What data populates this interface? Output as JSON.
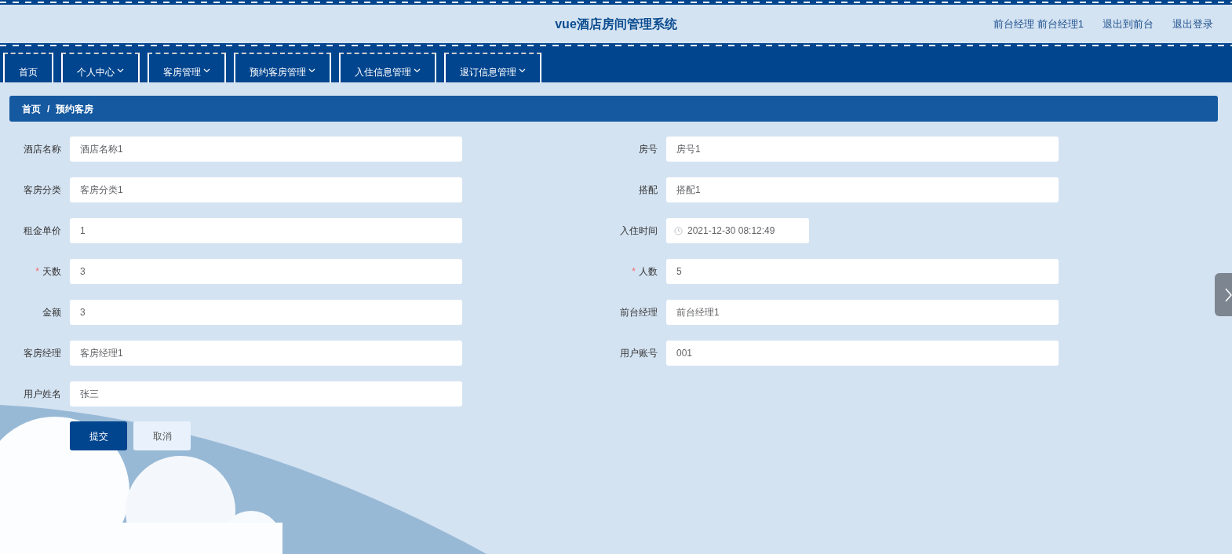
{
  "header": {
    "title": "vue酒店房间管理系统",
    "user": "前台经理 前台经理1",
    "links": [
      "退出到前台",
      "退出登录"
    ]
  },
  "nav": [
    {
      "label": "首页",
      "dropdown": false
    },
    {
      "label": "个人中心",
      "dropdown": true
    },
    {
      "label": "客房管理",
      "dropdown": true
    },
    {
      "label": "预约客房管理",
      "dropdown": true
    },
    {
      "label": "入住信息管理",
      "dropdown": true
    },
    {
      "label": "退订信息管理",
      "dropdown": true
    }
  ],
  "breadcrumb": {
    "items": [
      "首页",
      "预约客房"
    ],
    "separator": "/"
  },
  "form": {
    "required_mark": "*",
    "left_fields": [
      {
        "label": "酒店名称",
        "value": "酒店名称1",
        "required": false,
        "kind": "text"
      },
      {
        "label": "客房分类",
        "value": "客房分类1",
        "required": false,
        "kind": "text"
      },
      {
        "label": "租金单价",
        "value": "1",
        "required": false,
        "kind": "text"
      },
      {
        "label": "天数",
        "value": "3",
        "required": true,
        "kind": "text"
      },
      {
        "label": "金额",
        "value": "3",
        "required": false,
        "kind": "text"
      },
      {
        "label": "客房经理",
        "value": "客房经理1",
        "required": false,
        "kind": "text"
      },
      {
        "label": "用户姓名",
        "value": "张三",
        "required": false,
        "kind": "text"
      }
    ],
    "right_fields": [
      {
        "label": "房号",
        "value": "房号1",
        "required": false,
        "kind": "text"
      },
      {
        "label": "搭配",
        "value": "搭配1",
        "required": false,
        "kind": "text"
      },
      {
        "label": "入住时间",
        "value": "2021-12-30 08:12:49",
        "required": false,
        "kind": "date"
      },
      {
        "label": "人数",
        "value": "5",
        "required": true,
        "kind": "text"
      },
      {
        "label": "前台经理",
        "value": "前台经理1",
        "required": false,
        "kind": "text"
      },
      {
        "label": "用户账号",
        "value": "001",
        "required": false,
        "kind": "text"
      }
    ],
    "buttons": [
      {
        "label": "提交",
        "kind": "primary"
      },
      {
        "label": "取消",
        "kind": "secondary"
      }
    ]
  }
}
